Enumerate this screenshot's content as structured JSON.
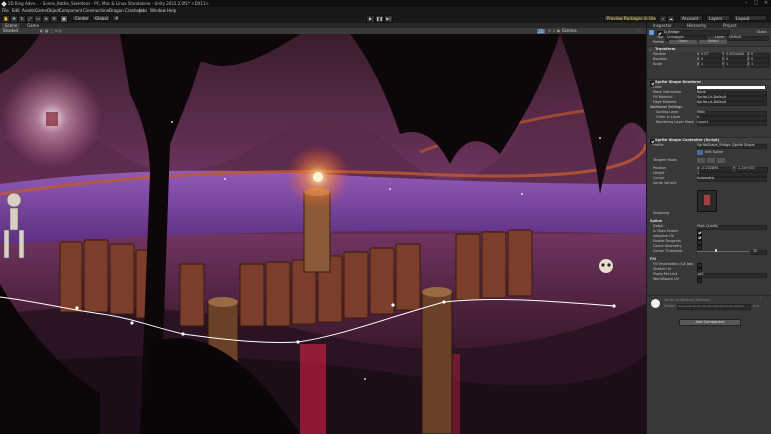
{
  "window": {
    "title": "2D King Adve... - Scene_Battle_Skeletons - PC, Mac & Linux Standalone - Unity 2022.2.0f1* <DX11>"
  },
  "menubar": [
    "File",
    "Edit",
    "Assets",
    "GameObject",
    "Component",
    "Cinemachine",
    "Dragon Crashers",
    "Jobs",
    "Window",
    "Help"
  ],
  "toolbar": {
    "pivot": "Center",
    "space": "Global",
    "preview_packages": "Preview Packages in Use",
    "account": "Account",
    "layers": "Layers",
    "layout": "Layout"
  },
  "scene": {
    "tabs": [
      "Scene",
      "Game"
    ],
    "shading": "Shaded",
    "mode_2d": "2D",
    "gizmos": "Gizmos"
  },
  "inspector": {
    "tabs": [
      "Inspector",
      "Hierarchy",
      "Project"
    ],
    "object_name": "D_Bridge",
    "static_label": "Static",
    "tag_label": "Tag",
    "tag": "Untagged",
    "layer_label": "Layer",
    "layer": "Default",
    "prefab_label": "Prefab",
    "prefab_open": "Open",
    "prefab_select": "Select",
    "transform": {
      "title": "Transform",
      "position_label": "Position",
      "rotation_label": "Rotation",
      "scale_label": "Scale",
      "pos": [
        "X",
        "0.07",
        "Y",
        "0.0034445",
        "Z",
        "0"
      ],
      "rot": [
        "X",
        "0",
        "Y",
        "0",
        "Z",
        "0"
      ],
      "scl": [
        "X",
        "1",
        "Y",
        "1",
        "Z",
        "1"
      ]
    },
    "renderer": {
      "title": "Sprite Shape Renderer",
      "rows": [
        {
          "label": "Color",
          "value": ""
        },
        {
          "label": "Mask Interaction",
          "value": "None"
        },
        {
          "label": "Fill Material",
          "value": "Sprite-Lit-Default"
        },
        {
          "label": "Edge Material",
          "value": "Sprite-Lit-Default"
        }
      ],
      "additional": "Additional Settings",
      "extra_rows": [
        {
          "label": "Sorting Layer",
          "value": "Main"
        },
        {
          "label": "Order in Layer",
          "value": "0"
        },
        {
          "label": "Rendering Layer Mask",
          "value": "Layer1"
        }
      ]
    },
    "controller": {
      "title": "Sprite Shape Controller (Script)",
      "profile_label": "Profile",
      "profile": "SpriteShape_Bridge (Sprite Shape",
      "edit_spline": "Edit Spline",
      "tangent_label": "Tangent Mode",
      "position_label": "Position",
      "position": [
        "X",
        "-0.202894",
        "Y",
        "-1.24+437"
      ],
      "height_label": "Height",
      "height": "1",
      "corner_label": "Corner",
      "corner": "Automatic",
      "sprite_variant_label": "Sprite Variant",
      "snapping_label": "Snapping",
      "spline_section": "Spline",
      "detail_label": "Detail",
      "detail": "High Quality",
      "open_ended_label": "Is Open Ended",
      "adaptive_label": "Adaptive UV",
      "enable_tangents_label": "Enable Tangents",
      "cache_geometry_label": "Cache Geometry",
      "corner_threshold_label": "Corner Threshold",
      "corner_threshold": "30",
      "fill_section": "Fill",
      "fill_tess_label": "Fill Tessellation (C# Job)",
      "stretch_uv_label": "Stretch UV",
      "pixel_per_unit_label": "Pixels Per Unit",
      "pixel_per_unit": "100",
      "world_space_label": "WorldSpace UV",
      "material_name": "Sprite-Lit-Default (Material)",
      "shader_label": "Shader",
      "shader_value": "Universal Render Pipeline/2D/Sprite-Lit-Default",
      "edit_label": "Edit...",
      "add_component": "Add Component"
    }
  },
  "colors": {
    "accent": "#3b79d6",
    "spline": "#ffffff",
    "bg_panel": "#383838"
  }
}
